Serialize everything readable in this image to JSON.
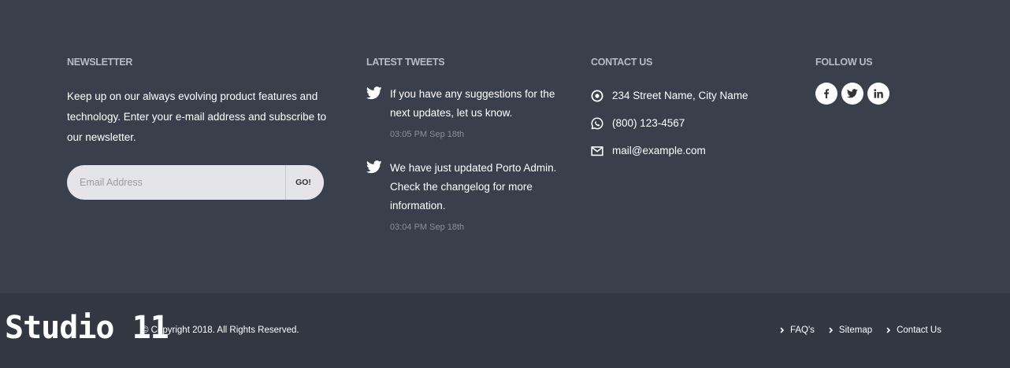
{
  "newsletter": {
    "title": "NEWSLETTER",
    "text": "Keep up on our always evolving product features and technology. Enter your e-mail address and subscribe to our newsletter.",
    "input_placeholder": "Email Address",
    "button_label": "GO!"
  },
  "tweets": {
    "title": "LATEST TWEETS",
    "items": [
      {
        "icon": "twitter-icon",
        "text": "If you have any suggestions for the next updates, let us know.",
        "time": "03:05 PM Sep 18th"
      },
      {
        "icon": "twitter-icon",
        "text": "We have just updated Porto Admin. Check the changelog for more information.",
        "time": "03:04 PM Sep 18th"
      }
    ]
  },
  "contact": {
    "title": "CONTACT US",
    "items": [
      {
        "icon": "location-icon",
        "text": "234 Street Name, City Name"
      },
      {
        "icon": "whatsapp-icon",
        "text": "(800) 123-4567"
      },
      {
        "icon": "envelope-icon",
        "text": "mail@example.com"
      }
    ]
  },
  "follow": {
    "title": "FOLLOW US",
    "icons": [
      "facebook-icon",
      "twitter-icon",
      "linkedin-icon"
    ]
  },
  "bottom": {
    "logo": "Studio 11",
    "copyright": "© Copyright 2018. All Rights Reserved.",
    "links": [
      "FAQ's",
      "Sitemap",
      "Contact Us"
    ]
  },
  "colors": {
    "footer_bg": "#3a404b",
    "bottom_bg": "#323742",
    "heading": "#b8bcc3",
    "muted": "#8a8f98",
    "input_bg": "#e5e4e9"
  }
}
